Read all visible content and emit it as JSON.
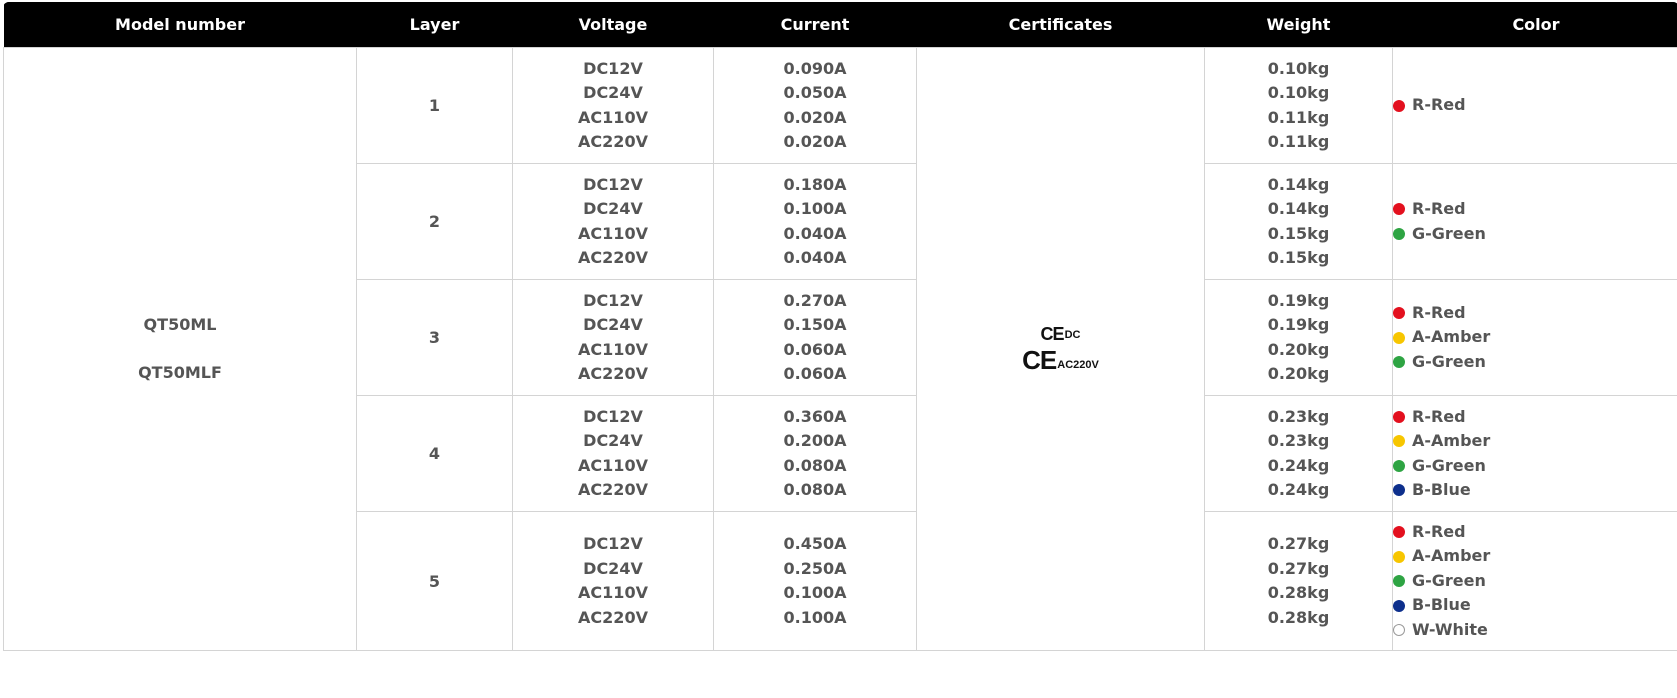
{
  "headers": [
    "Model number",
    "Layer",
    "Voltage",
    "Current",
    "Certificates",
    "Weight",
    "Color"
  ],
  "models": [
    "QT50ML",
    "QT50MLF"
  ],
  "certificates": {
    "line1_mark": "CE",
    "line1_sub": "DC",
    "line2_mark": "CE",
    "line2_sub": "AC220V"
  },
  "color_values": {
    "red": "#e3101e",
    "amber": "#f7c600",
    "green": "#2ea443",
    "blue": "#0d2f8c",
    "white": "#ffffff"
  },
  "rows": [
    {
      "layer": "1",
      "voltages": [
        "DC12V",
        "DC24V",
        "AC110V",
        "AC220V"
      ],
      "currents": [
        "0.090A",
        "0.050A",
        "0.020A",
        "0.020A"
      ],
      "weights": [
        "0.10kg",
        "0.10kg",
        "0.11kg",
        "0.11kg"
      ],
      "colors": [
        {
          "label": "R-Red",
          "key": "red"
        }
      ]
    },
    {
      "layer": "2",
      "voltages": [
        "DC12V",
        "DC24V",
        "AC110V",
        "AC220V"
      ],
      "currents": [
        "0.180A",
        "0.100A",
        "0.040A",
        "0.040A"
      ],
      "weights": [
        "0.14kg",
        "0.14kg",
        "0.15kg",
        "0.15kg"
      ],
      "colors": [
        {
          "label": "R-Red",
          "key": "red"
        },
        {
          "label": "G-Green",
          "key": "green"
        }
      ]
    },
    {
      "layer": "3",
      "voltages": [
        "DC12V",
        "DC24V",
        "AC110V",
        "AC220V"
      ],
      "currents": [
        "0.270A",
        "0.150A",
        "0.060A",
        "0.060A"
      ],
      "weights": [
        "0.19kg",
        "0.19kg",
        "0.20kg",
        "0.20kg"
      ],
      "colors": [
        {
          "label": "R-Red",
          "key": "red"
        },
        {
          "label": "A-Amber",
          "key": "amber"
        },
        {
          "label": "G-Green",
          "key": "green"
        }
      ]
    },
    {
      "layer": "4",
      "voltages": [
        "DC12V",
        "DC24V",
        "AC110V",
        "AC220V"
      ],
      "currents": [
        "0.360A",
        "0.200A",
        "0.080A",
        "0.080A"
      ],
      "weights": [
        "0.23kg",
        "0.23kg",
        "0.24kg",
        "0.24kg"
      ],
      "colors": [
        {
          "label": "R-Red",
          "key": "red"
        },
        {
          "label": "A-Amber",
          "key": "amber"
        },
        {
          "label": "G-Green",
          "key": "green"
        },
        {
          "label": "B-Blue",
          "key": "blue"
        }
      ]
    },
    {
      "layer": "5",
      "voltages": [
        "DC12V",
        "DC24V",
        "AC110V",
        "AC220V"
      ],
      "currents": [
        "0.450A",
        "0.250A",
        "0.100A",
        "0.100A"
      ],
      "weights": [
        "0.27kg",
        "0.27kg",
        "0.28kg",
        "0.28kg"
      ],
      "colors": [
        {
          "label": "R-Red",
          "key": "red"
        },
        {
          "label": "A-Amber",
          "key": "amber"
        },
        {
          "label": "G-Green",
          "key": "green"
        },
        {
          "label": "B-Blue",
          "key": "blue"
        },
        {
          "label": "W-White",
          "key": "white"
        }
      ]
    }
  ]
}
